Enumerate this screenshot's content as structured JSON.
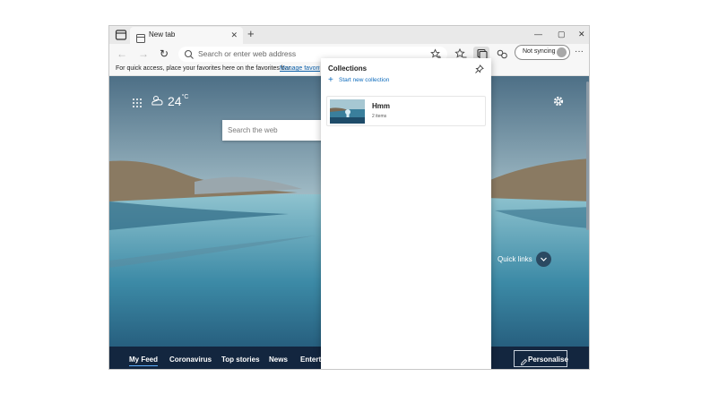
{
  "tab": {
    "title": "New tab",
    "close": "✕",
    "new": "+"
  },
  "window_controls": {
    "minimize": "—",
    "maximize": "▢",
    "close": "✕"
  },
  "toolbar": {
    "back": "←",
    "forward": "→",
    "refresh": "↻",
    "address_placeholder": "Search or enter web address",
    "sync_label": "Not syncing",
    "more": "···"
  },
  "favorites_bar": {
    "text": "For quick access, place your favorites here on the favorites bar.",
    "link": "Manage favorites"
  },
  "newtab": {
    "temperature": "24",
    "temp_unit": "°C",
    "search_placeholder": "Search the web",
    "quick_links": "Quick links",
    "feed": [
      {
        "label": "My Feed",
        "active": true
      },
      {
        "label": "Coronavirus"
      },
      {
        "label": "Top stories"
      },
      {
        "label": "News"
      },
      {
        "label": "Entertainment"
      }
    ],
    "personalise": "Personalise"
  },
  "collections_panel": {
    "title": "Collections",
    "start_new": "Start new collection",
    "items": [
      {
        "name": "Hmm",
        "count": "2 items"
      }
    ]
  },
  "colors": {
    "accent": "#0f6cbd",
    "feed_bar": "#13263f",
    "active_tab_underline": "#5fb0ff"
  }
}
